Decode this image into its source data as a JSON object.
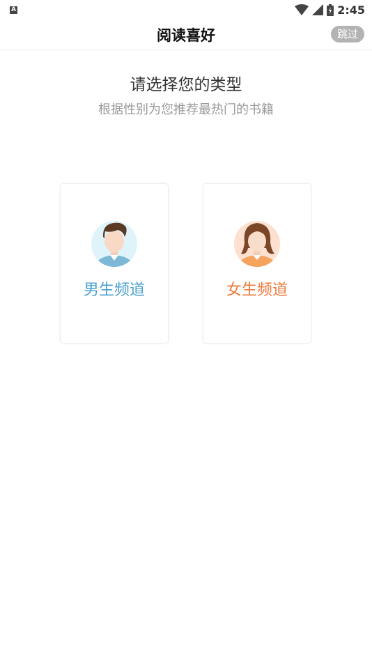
{
  "status_bar": {
    "notification_icon": "A",
    "time": "2:45",
    "icons": [
      "wifi-icon",
      "signal-icon",
      "battery-icon"
    ]
  },
  "header": {
    "title": "阅读喜好",
    "skip_label": "跳过"
  },
  "main": {
    "heading": "请选择您的类型",
    "subheading": "根据性别为您推荐最热门的书籍",
    "cards": [
      {
        "label": "男生频道",
        "color": "#4a9fd0",
        "icon": "male-avatar-icon"
      },
      {
        "label": "女生频道",
        "color": "#f07a3c",
        "icon": "female-avatar-icon"
      }
    ]
  }
}
